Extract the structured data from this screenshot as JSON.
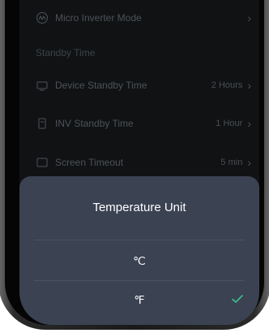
{
  "settings": {
    "micro_inverter": {
      "label": "Micro Inverter Mode",
      "icon": "inverter-icon"
    },
    "standby_section": "Standby Time",
    "device_standby": {
      "label": "Device Standby Time",
      "value": "2 Hours",
      "icon": "device-icon"
    },
    "inv_standby": {
      "label": "INV Standby Time",
      "value": "1 Hour",
      "icon": "inv-icon"
    },
    "screen_timeout": {
      "label": "Screen Timeout",
      "value": "5 min",
      "icon": "screen-icon"
    }
  },
  "sheet": {
    "title": "Temperature Unit",
    "options": [
      {
        "label": "℃",
        "selected": false
      },
      {
        "label": "℉",
        "selected": true
      }
    ],
    "accent": "#3fbf8a"
  }
}
